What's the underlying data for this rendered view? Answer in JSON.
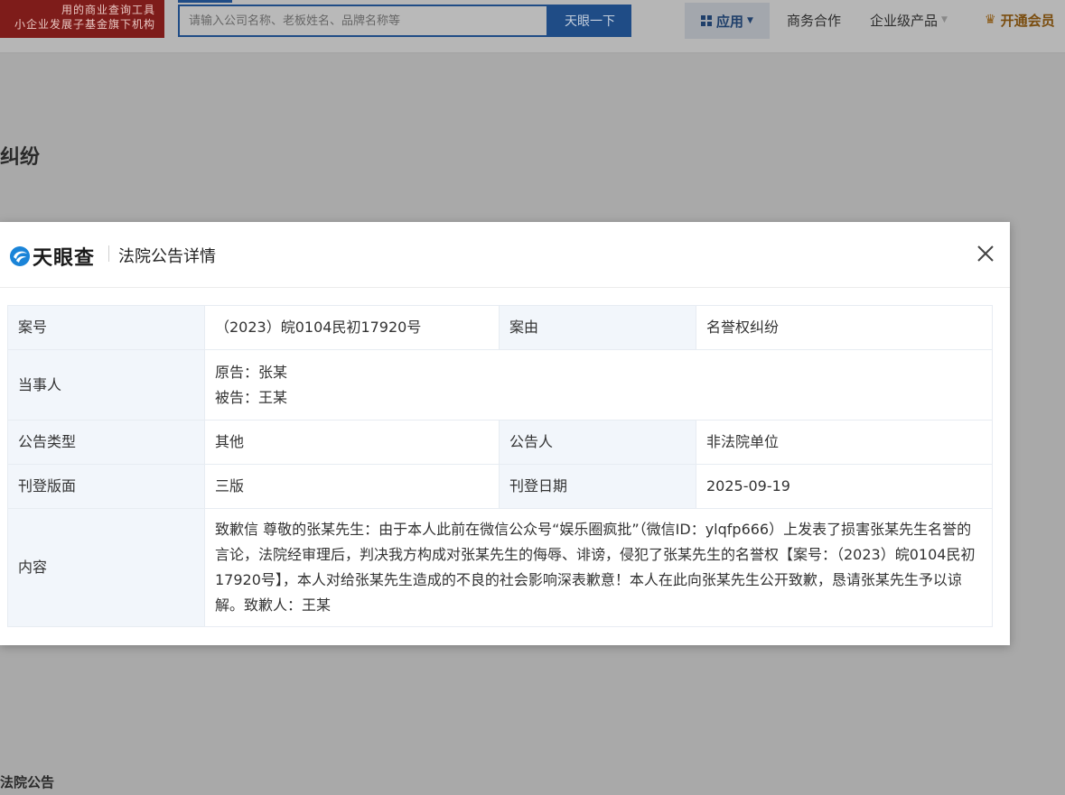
{
  "topbar": {
    "promo_line1": "用的商业查询工具",
    "promo_line2": "小企业发展子基金旗下机构",
    "search_placeholder": "请输入公司名称、老板姓名、品牌名称等",
    "search_button": "天眼一下",
    "nav_app": "应用",
    "nav_business": "商务合作",
    "nav_enterprise": "企业级产品",
    "nav_vip": "开通会员"
  },
  "background": {
    "page_title": "纠纷",
    "section_title": "法院公告"
  },
  "modal": {
    "logo_text": "天眼查",
    "title": "法院公告详情",
    "rows": {
      "case_no_label": "案号",
      "case_no_value": "（2023）皖0104民初17920号",
      "cause_label": "案由",
      "cause_value": "名誉权纠纷",
      "party_label": "当事人",
      "plaintiff": "原告：张某",
      "defendant": "被告：王某",
      "type_label": "公告类型",
      "type_value": "其他",
      "announcer_label": "公告人",
      "announcer_value": "非法院单位",
      "page_label": "刊登版面",
      "page_value": "三版",
      "date_label": "刊登日期",
      "date_value": "2025-09-19",
      "content_label": "内容",
      "content_value": "致歉信 尊敬的张某先生：由于本人此前在微信公众号“娱乐圈疯批”（微信ID：ylqfp666）上发表了损害张某先生名誉的言论，法院经审理后，判决我方构成对张某先生的侮辱、诽谤，侵犯了张某先生的名誉权【案号：（2023）皖0104民初17920号】，本人对给张某先生造成的不良的社会影响深表歉意！本人在此向张某先生公开致歉，恳请张某先生予以谅解。致歉人：王某"
    }
  },
  "colors": {
    "overlay": "#a9a9a9",
    "brand_blue": "#1f4c86",
    "label_bg": "#f2f6fb",
    "promo_red": "#7e1c1a"
  },
  "icons": {
    "logo": "tianyancha-logo-icon",
    "close": "close-icon",
    "app": "grid-icon",
    "vip": "crown-icon",
    "dropdown": "chevron-down-icon"
  }
}
